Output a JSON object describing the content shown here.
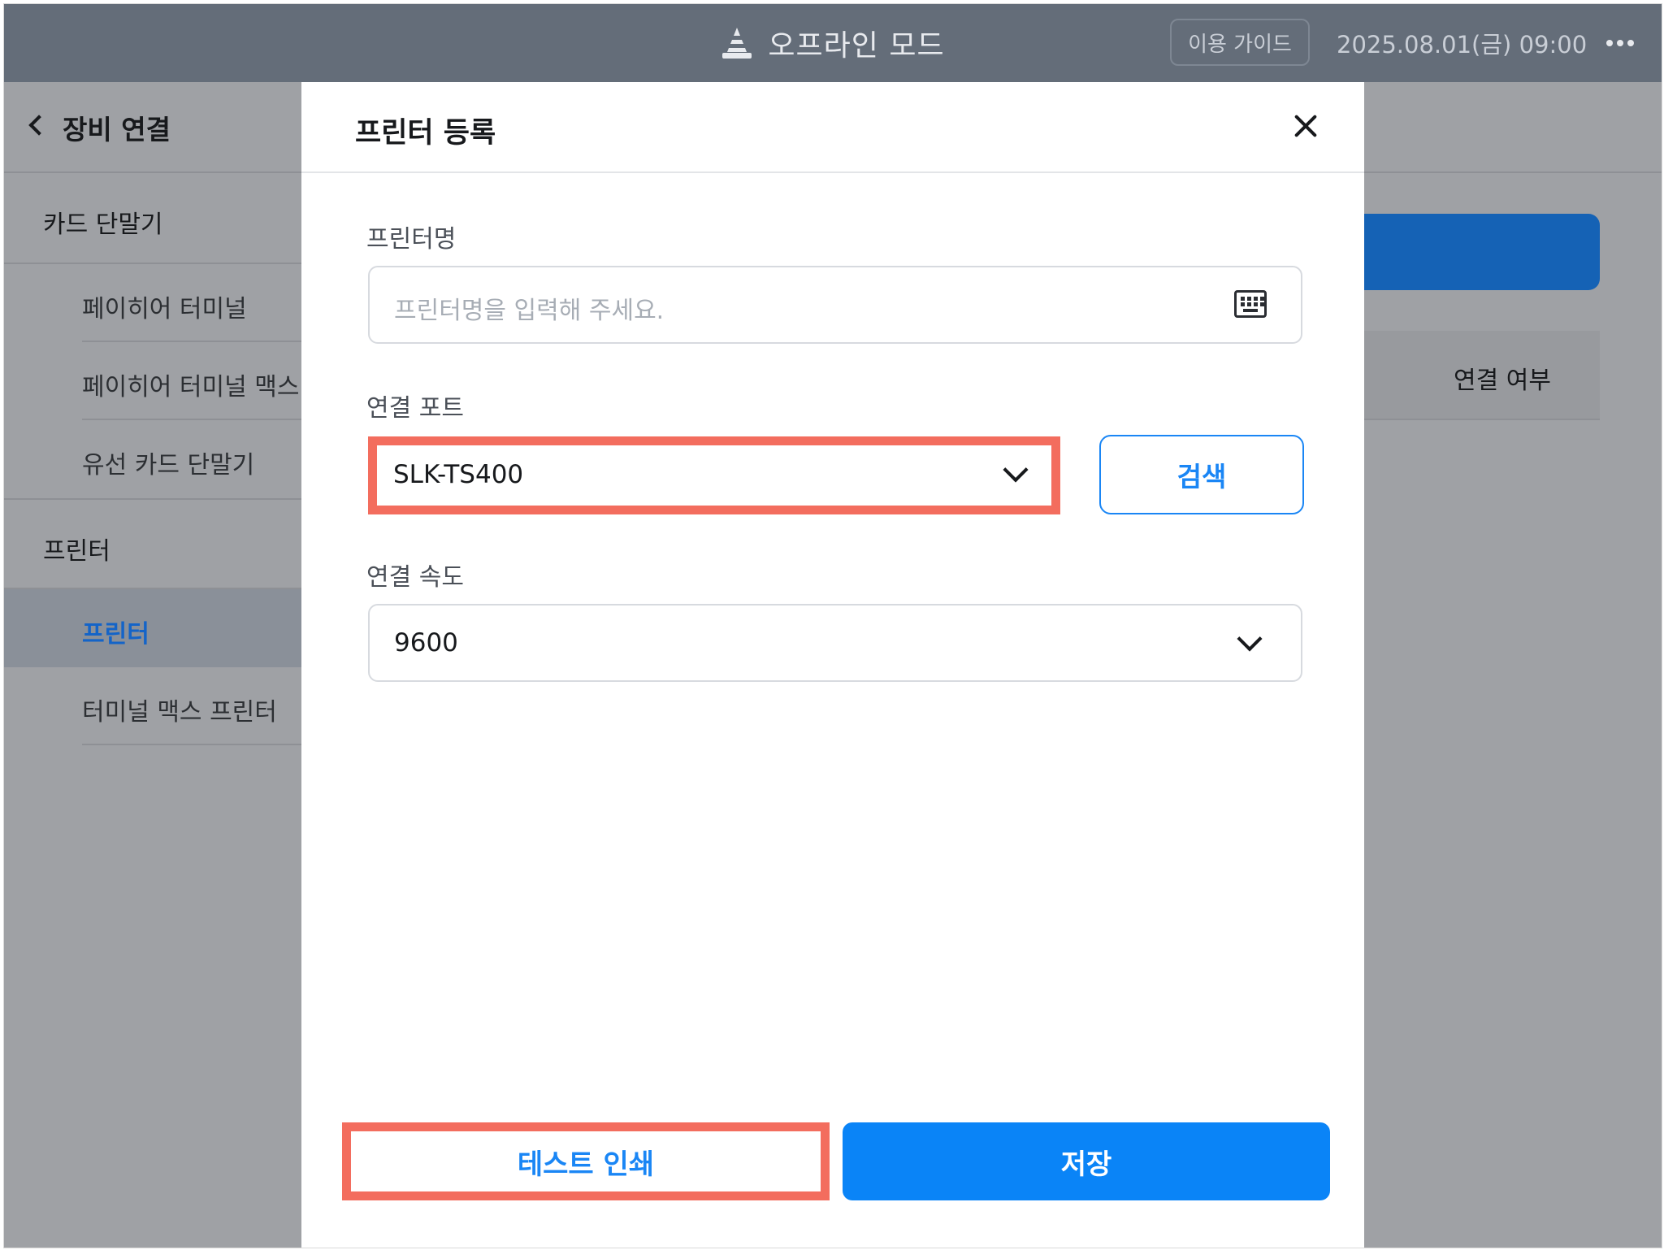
{
  "topbar": {
    "mode_label": "오프라인 모드",
    "guide_label": "이용 가이드",
    "datetime": "2025.08.01(금) 09:00"
  },
  "sidebar": {
    "title": "장비 연결",
    "categories": [
      {
        "label": "카드 단말기",
        "items": [
          "페이히어 터미널",
          "페이히어 터미널 맥스",
          "유선 카드 단말기"
        ]
      },
      {
        "label": "프린터",
        "items": [
          "프린터",
          "터미널 맥스 프린터"
        ]
      }
    ],
    "active_item": "프린터"
  },
  "background": {
    "column_header": "연결 여부"
  },
  "modal": {
    "title": "프린터 등록",
    "printer_name": {
      "label": "프린터명",
      "placeholder": "프린터명을 입력해 주세요.",
      "value": ""
    },
    "port": {
      "label": "연결 포트",
      "selected": "SLK-TS400",
      "search_label": "검색"
    },
    "speed": {
      "label": "연결 속도",
      "selected": "9600"
    },
    "test_print_label": "테스트 인쇄",
    "save_label": "저장"
  },
  "colors": {
    "accent": "#0a84f7",
    "highlight": "#f36d5e",
    "topbar": "#646d79"
  }
}
